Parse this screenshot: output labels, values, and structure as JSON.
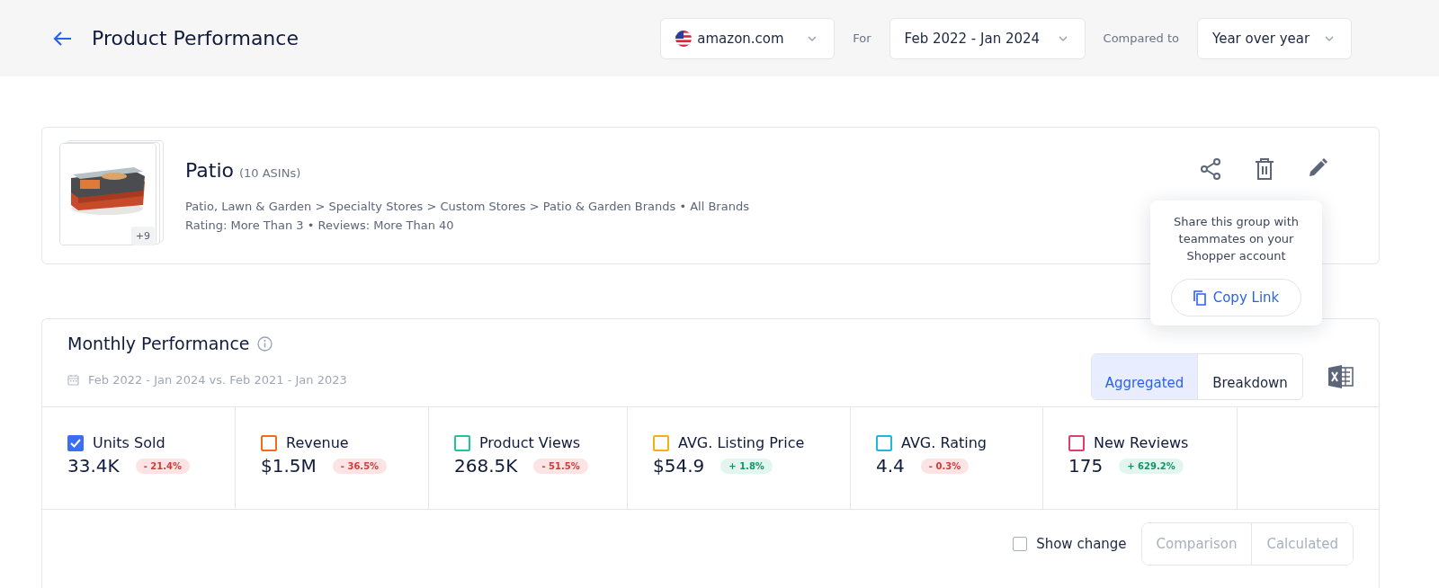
{
  "header": {
    "title": "Product Performance",
    "marketplace": "amazon.com",
    "for_label": "For",
    "period": "Feb 2022 - Jan 2024",
    "compare_label": "Compared to",
    "comparison": "Year over year"
  },
  "product_group": {
    "name": "Patio",
    "count": "(10 ASINs)",
    "more_badge": "+9",
    "category_path": "Patio, Lawn & Garden > Specialty Stores > Custom Stores > Patio & Garden Brands • All Brands",
    "filters": "Rating: More Than 3 • Reviews: More Than 40"
  },
  "share_tooltip": {
    "message": "Share this group with teammates on your Shopper account",
    "button": "Copy Link"
  },
  "monthly_performance": {
    "title": "Monthly Performance",
    "date_range": "Feb 2022 - Jan 2024 vs. Feb 2021 - Jan 2023",
    "view_tabs": [
      {
        "label": "Aggregated",
        "selected": true
      },
      {
        "label": "Breakdown",
        "selected": false
      }
    ],
    "metrics": [
      {
        "label": "Units Sold",
        "value": "33.4K",
        "change": "- 21.4%",
        "increase": false,
        "checked": true,
        "color": "#3d6df2"
      },
      {
        "label": "Revenue",
        "value": "$1.5M",
        "change": "- 36.5%",
        "increase": false,
        "checked": false,
        "color": "#f06d1a"
      },
      {
        "label": "Product Views",
        "value": "268.5K",
        "change": "- 51.5%",
        "increase": false,
        "checked": false,
        "color": "#1fc49a"
      },
      {
        "label": "AVG. Listing Price",
        "value": "$54.9",
        "change": "+ 1.8%",
        "increase": true,
        "checked": false,
        "color": "#f5b014"
      },
      {
        "label": "AVG. Rating",
        "value": "4.4",
        "change": "- 0.3%",
        "increase": false,
        "checked": false,
        "color": "#1cb8e0"
      },
      {
        "label": "New Reviews",
        "value": "175",
        "change": "+ 629.2%",
        "increase": true,
        "checked": false,
        "color": "#e23d6a"
      }
    ],
    "show_change": {
      "label": "Show change",
      "checked": false
    },
    "change_modes": [
      {
        "label": "Comparison",
        "disabled": true
      },
      {
        "label": "Calculated",
        "disabled": true
      }
    ]
  }
}
